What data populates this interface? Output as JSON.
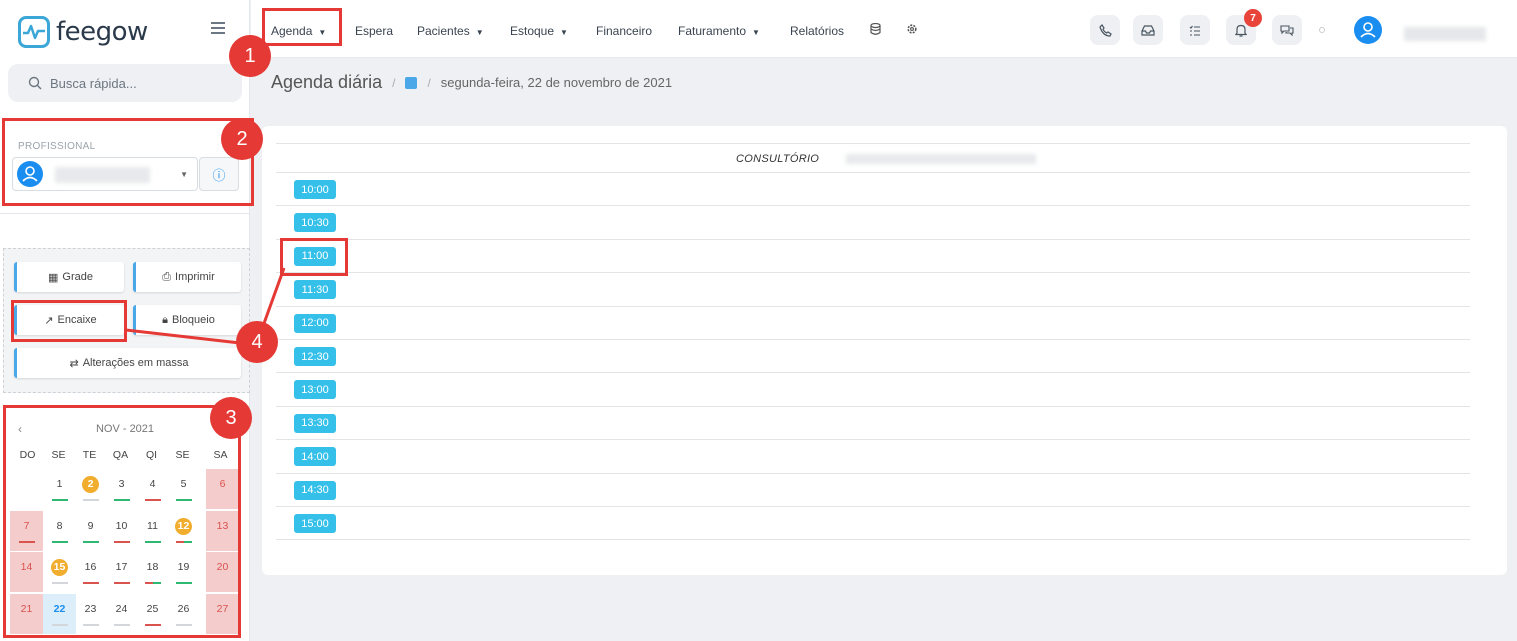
{
  "brand": {
    "name": "feegow"
  },
  "search": {
    "placeholder": "Busca rápida..."
  },
  "topnav": {
    "items": [
      {
        "label": "Agenda",
        "dropdown": true
      },
      {
        "label": "Espera",
        "dropdown": false
      },
      {
        "label": "Pacientes",
        "dropdown": true
      },
      {
        "label": "Estoque",
        "dropdown": true
      },
      {
        "label": "Financeiro",
        "dropdown": false
      },
      {
        "label": "Faturamento",
        "dropdown": true
      },
      {
        "label": "Relatórios",
        "dropdown": false
      }
    ],
    "icons": [
      "database-icon",
      "gear-icon"
    ],
    "right_icons": [
      "phone-icon",
      "inbox-icon",
      "checklist-icon",
      "bell-icon",
      "chat-icon"
    ],
    "notification_count": "7"
  },
  "breadcrumb": {
    "title": "Agenda diária",
    "date": "segunda-feira, 22 de novembro de 2021"
  },
  "professional": {
    "label": "PROFISSIONAL"
  },
  "actions": {
    "grade": "Grade",
    "imprimir": "Imprimir",
    "encaixe": "Encaixe",
    "bloqueio": "Bloqueio",
    "alteracoes": "Alterações em massa"
  },
  "calendar": {
    "month_label": "NOV - 2021",
    "dow": [
      "DO",
      "SE",
      "TE",
      "QA",
      "QI",
      "SE",
      "SA"
    ],
    "weeks": [
      [
        {
          "d": "",
          "w": false,
          "bar": ""
        },
        {
          "d": "1",
          "w": false,
          "bar": "green"
        },
        {
          "d": "2",
          "w": false,
          "bar": "grey",
          "badge": true
        },
        {
          "d": "3",
          "w": false,
          "bar": "green"
        },
        {
          "d": "4",
          "w": false,
          "bar": "red"
        },
        {
          "d": "5",
          "w": false,
          "bar": "green"
        },
        {
          "d": "6",
          "w": true,
          "bar": ""
        }
      ],
      [
        {
          "d": "7",
          "w": true,
          "bar": "red"
        },
        {
          "d": "8",
          "w": false,
          "bar": "green"
        },
        {
          "d": "9",
          "w": false,
          "bar": "green"
        },
        {
          "d": "10",
          "w": false,
          "bar": "red"
        },
        {
          "d": "11",
          "w": false,
          "bar": "green"
        },
        {
          "d": "12",
          "w": false,
          "bar": "mix",
          "badge": true
        },
        {
          "d": "13",
          "w": true,
          "bar": ""
        }
      ],
      [
        {
          "d": "14",
          "w": true,
          "bar": ""
        },
        {
          "d": "15",
          "w": false,
          "bar": "grey",
          "badge": true
        },
        {
          "d": "16",
          "w": false,
          "bar": "red"
        },
        {
          "d": "17",
          "w": false,
          "bar": "red"
        },
        {
          "d": "18",
          "w": false,
          "bar": "mix"
        },
        {
          "d": "19",
          "w": false,
          "bar": "green"
        },
        {
          "d": "20",
          "w": true,
          "bar": ""
        }
      ],
      [
        {
          "d": "21",
          "w": true,
          "bar": ""
        },
        {
          "d": "22",
          "w": false,
          "bar": "grey",
          "today": true
        },
        {
          "d": "23",
          "w": false,
          "bar": "grey"
        },
        {
          "d": "24",
          "w": false,
          "bar": "grey"
        },
        {
          "d": "25",
          "w": false,
          "bar": "red"
        },
        {
          "d": "26",
          "w": false,
          "bar": "grey"
        },
        {
          "d": "27",
          "w": true,
          "bar": ""
        }
      ]
    ]
  },
  "schedule": {
    "room_label": "CONSULTÓRIO",
    "slots": [
      "10:00",
      "10:30",
      "11:00",
      "11:30",
      "12:00",
      "12:30",
      "13:00",
      "13:30",
      "14:00",
      "14:30",
      "15:00"
    ]
  },
  "annotations": {
    "steps": [
      "1",
      "2",
      "3",
      "4"
    ]
  },
  "colors": {
    "accent": "#1a8df0",
    "slot": "#35c0ea",
    "annotation": "#e53935",
    "badge": "#f0ad2e"
  }
}
